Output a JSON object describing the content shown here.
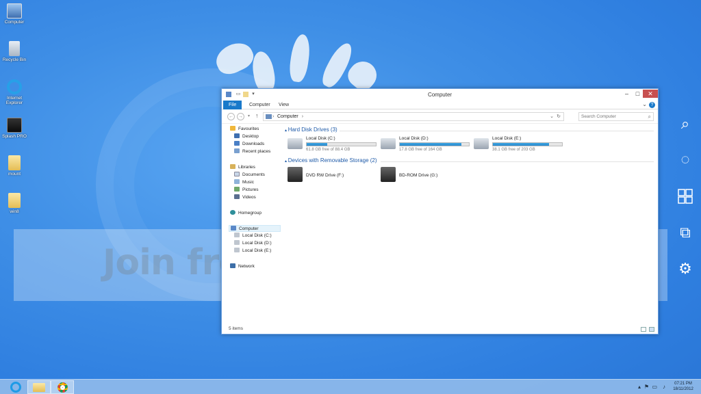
{
  "watermark": {
    "logo": "photobucket",
    "slogan": "Join free. Share privately."
  },
  "desktop_icons": [
    {
      "label": "Computer",
      "icon": "computer-icon"
    },
    {
      "label": "Recycle Bin",
      "icon": "recycle-bin-icon"
    },
    {
      "label": "Internet Explorer",
      "icon": "internet-explorer-icon"
    },
    {
      "label": "Splash PRO",
      "icon": "splash-pro-icon"
    },
    {
      "label": "mount",
      "icon": "folder-icon"
    },
    {
      "label": "win8",
      "icon": "folder-icon"
    }
  ],
  "window": {
    "title": "Computer",
    "ribbon_tabs": [
      "File",
      "Computer",
      "View"
    ],
    "address": "Computer",
    "search_placeholder": "Search Computer",
    "status": "5 items"
  },
  "nav": {
    "favourites": "Favourites",
    "favourite_items": [
      "Desktop",
      "Downloads",
      "Recent places"
    ],
    "libraries": "Libraries",
    "library_items": [
      "Documents",
      "Music",
      "Pictures",
      "Videos"
    ],
    "homegroup": "Homegroup",
    "computer": "Computer",
    "computer_items": [
      "Local Disk (C:)",
      "Local Disk (D:)",
      "Local Disk (E:)"
    ],
    "network": "Network"
  },
  "groups": {
    "hard_disks": "Hard Disk Drives (3)",
    "removable": "Devices with Removable Storage (2)"
  },
  "drives": [
    {
      "name": "Local Disk (C:)",
      "free": "61.8 GB free of 88.4 GB",
      "used_fraction": 0.3
    },
    {
      "name": "Local Disk (D:)",
      "free": "17.8 GB free of 164 GB",
      "used_fraction": 0.89
    },
    {
      "name": "Local Disk (E:)",
      "free": "38.1 GB free of 203 GB",
      "used_fraction": 0.81
    }
  ],
  "removable": [
    {
      "name": "DVD RW Drive (F:)",
      "icon": "dvd-drive-icon"
    },
    {
      "name": "BD-ROM Drive (G:)",
      "icon": "bd-drive-icon"
    }
  ],
  "taskbar": {
    "time": "07:21 PM",
    "date": "18/11/2012"
  },
  "colors": {
    "accent": "#1979ca",
    "drive_fill": "#2589d0",
    "close_button": "#c75050",
    "desktop": "#3f8fe6"
  }
}
